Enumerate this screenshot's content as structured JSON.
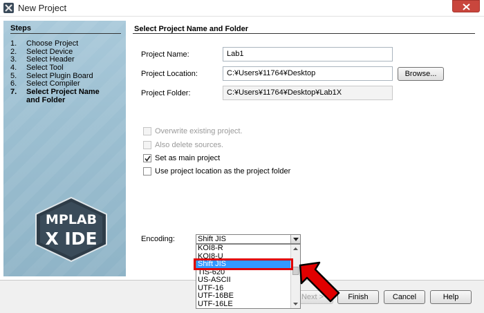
{
  "window": {
    "title": "New Project"
  },
  "sidebar": {
    "heading": "Steps",
    "steps": [
      {
        "num": "1.",
        "label": "Choose Project"
      },
      {
        "num": "2.",
        "label": "Select Device"
      },
      {
        "num": "3.",
        "label": "Select Header"
      },
      {
        "num": "4.",
        "label": "Select Tool"
      },
      {
        "num": "5.",
        "label": "Select Plugin Board"
      },
      {
        "num": "6.",
        "label": "Select Compiler"
      },
      {
        "num": "7.",
        "label": "Select Project Name"
      }
    ],
    "current_step_cont": "and Folder",
    "logo_line1": "MPLAB",
    "logo_line2": "X IDE"
  },
  "main": {
    "title": "Select Project Name and Folder",
    "project_name_label": "Project Name:",
    "project_name_value": "Lab1",
    "project_location_label": "Project Location:",
    "project_location_value": "C:¥Users¥11764¥Desktop",
    "browse_label": "Browse...",
    "project_folder_label": "Project Folder:",
    "project_folder_value": "C:¥Users¥11764¥Desktop¥Lab1X",
    "overwrite_label": "Overwrite existing project.",
    "delete_sources_label": "Also delete sources.",
    "set_main_label": "Set as main project",
    "set_main_checked": true,
    "use_location_label": "Use project location as the project folder",
    "encoding_label": "Encoding:",
    "encoding_selected": "Shift JIS",
    "encoding_options": [
      "KOI8-R",
      "KOI8-U",
      "Shift JIS",
      "TIS-620",
      "US-ASCII",
      "UTF-16",
      "UTF-16BE",
      "UTF-16LE"
    ]
  },
  "footer": {
    "next_label": "Next >",
    "finish_label": "Finish",
    "cancel_label": "Cancel",
    "help_label": "Help"
  },
  "colors": {
    "selection": "#3399ff",
    "annotation": "#e00000",
    "sidebar": "#9cbfd1"
  }
}
